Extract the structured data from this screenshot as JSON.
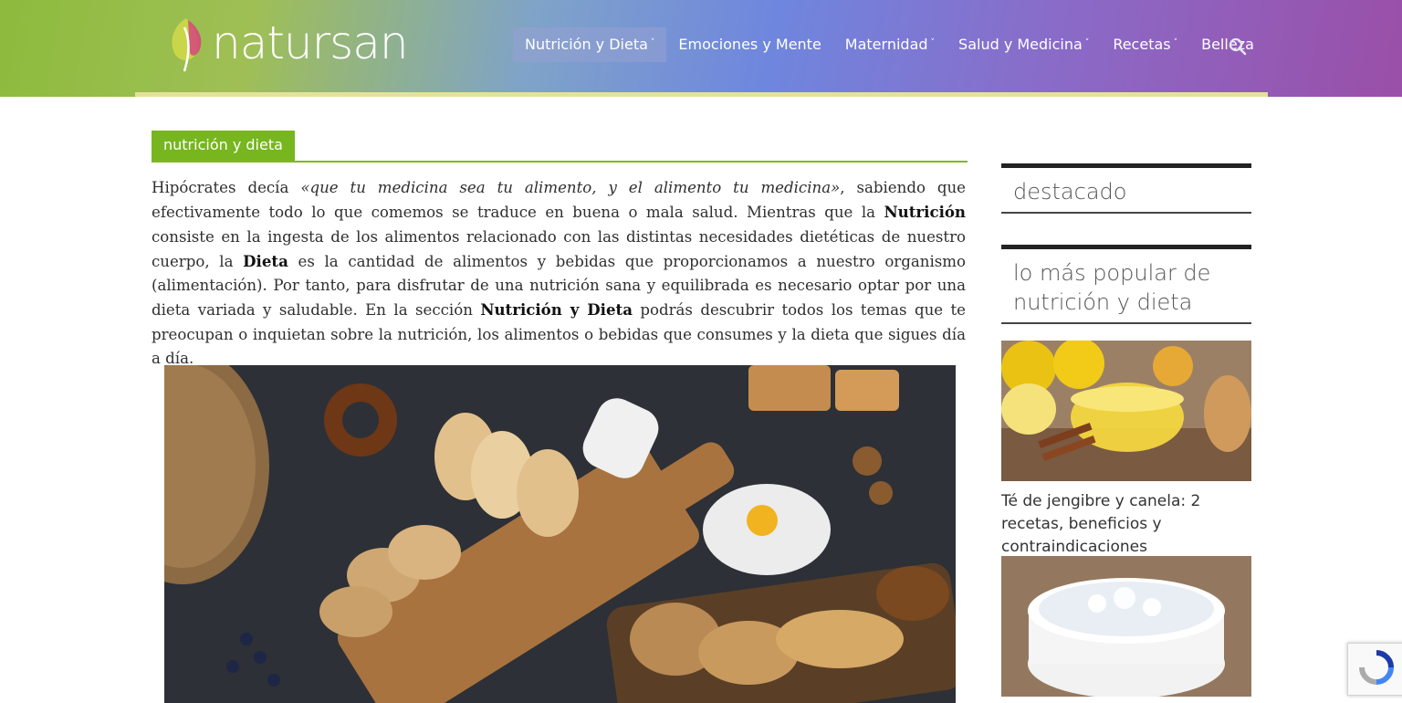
{
  "brand": {
    "name": "natursan"
  },
  "nav": {
    "items": [
      {
        "label": "Nutrición y Dieta",
        "dropdown": true,
        "active": true
      },
      {
        "label": "Emociones y Mente",
        "dropdown": false
      },
      {
        "label": "Maternidad",
        "dropdown": true
      },
      {
        "label": "Salud y Medicina",
        "dropdown": true
      },
      {
        "label": "Recetas",
        "dropdown": true
      },
      {
        "label": "Belleza",
        "dropdown": false
      }
    ],
    "caret": "˅",
    "search_icon": "search-icon"
  },
  "main": {
    "category": "nutrición y dieta",
    "intro": {
      "p1": "Hipócrates decía ",
      "quote": "«que tu medicina sea tu alimento, y el alimento tu medicina»",
      "p2": ", sabiendo que efectivamente todo lo que comemos se traduce en buena o mala salud. Mientras que la ",
      "b1": "Nutrición",
      "p3": " consiste en la ingesta de los alimentos relacionado con las distintas necesidades dietéticas de nuestro cuerpo, la ",
      "b2": "Dieta",
      "p4": " es la cantidad de alimentos y bebidas que proporcionamos a nuestro organismo (alimentación). Por tanto, para disfrutar de una nutrición sana y equilibrada es necesario optar por una dieta variada y saludable. En la sección ",
      "b3": "Nutrición y Dieta",
      "p5": " podrás descubrir todos los temas que te preocupan o inquietan sobre la nutrición, los alimentos o bebidas que consumes y la dieta que sigues día a día."
    }
  },
  "sidebar": {
    "featured_title": "destacado",
    "popular_title": "lo más popular de nutrición y dieta",
    "posts": [
      {
        "title": "Té de jengibre y canela: 2 recetas, beneficios y contraindicaciones"
      }
    ]
  },
  "colors": {
    "accent_green": "#77b61f",
    "header_gradient_start": "#8dbb3d",
    "header_gradient_end": "#9a4fa8"
  }
}
